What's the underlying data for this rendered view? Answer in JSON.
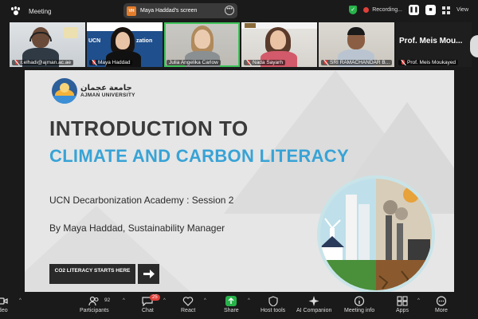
{
  "app": {
    "title": "Meeting",
    "screen_share_label": "Maya Haddad's screen",
    "presenter_initials": "VH",
    "recording_label": "Recording...",
    "view_label": "View"
  },
  "participants": [
    {
      "name": "r.elhadi@ajman.ac.ae"
    },
    {
      "name": "Maya Haddad"
    },
    {
      "name": "Julia Angelika Carlow"
    },
    {
      "name": "Nada Sayarh"
    },
    {
      "name": "SRI RAMACHANDAR B..."
    },
    {
      "name": "Prof. Meis Moukayed",
      "display": "Prof. Meis Mou..."
    }
  ],
  "slide": {
    "university_ar": "جامعة عجمان",
    "university_en": "AJMAN UNIVERSITY",
    "title_line1": "INTRODUCTION TO",
    "title_line2": "CLIMATE AND CARBON LITERACY",
    "subtitle": "UCN Decarbonization Academy : Session 2",
    "presenter": "By Maya Haddad, Sustainability Manager",
    "cta": "CO2 LITERACY STARTS HERE"
  },
  "toolbar": {
    "video": "ideo",
    "participants": "Participants",
    "participants_count": "92",
    "chat": "Chat",
    "chat_badge": "25",
    "react": "React",
    "share": "Share",
    "host_tools": "Host tools",
    "ai_companion": "AI Companion",
    "meeting_info": "Meeting info",
    "apps": "Apps",
    "more": "More"
  },
  "colors": {
    "accent_green": "#3fc25a",
    "record_red": "#e0403a",
    "slide_blue": "#38a3d6"
  }
}
